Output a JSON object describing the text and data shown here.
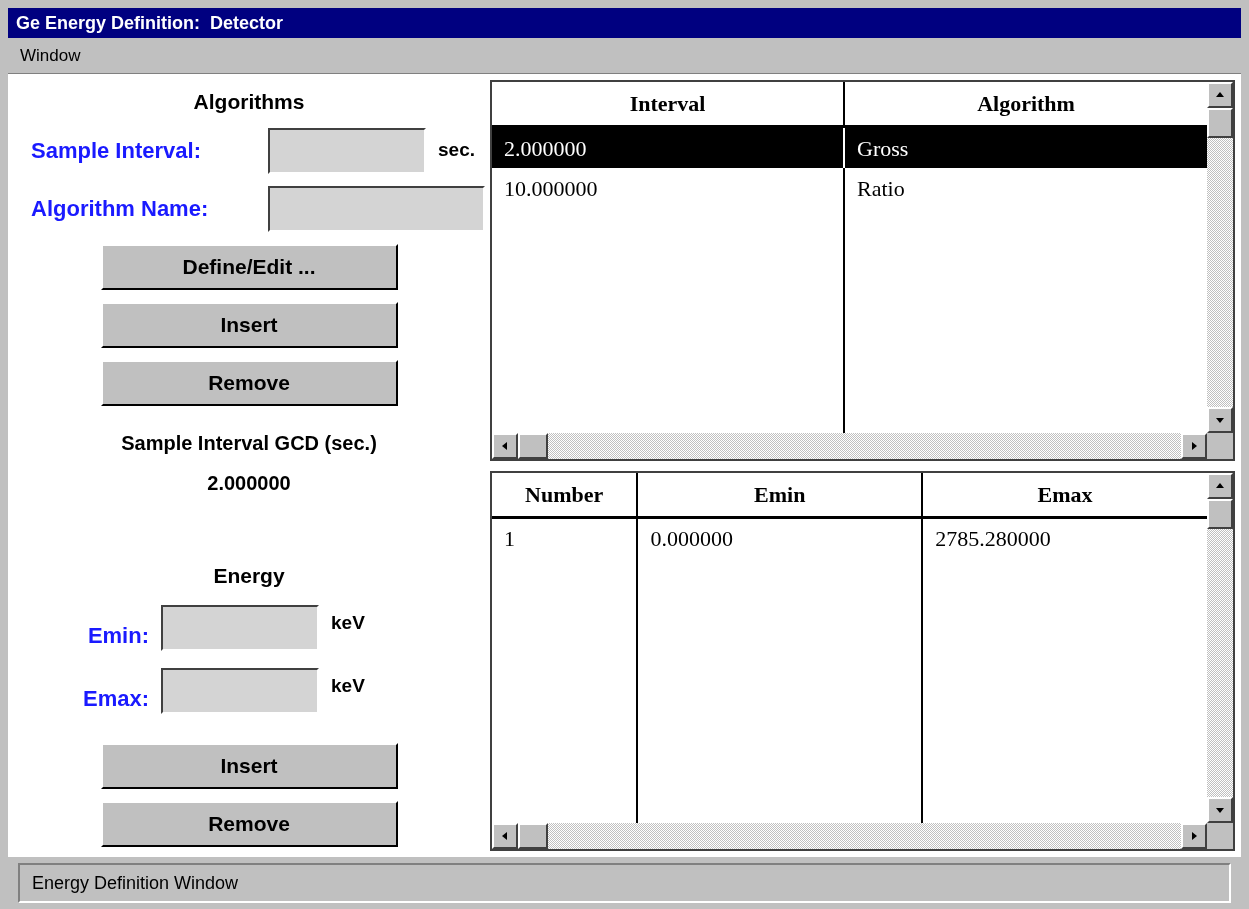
{
  "window": {
    "title": "Ge Energy Definition:  Detector"
  },
  "menu": [
    "Window"
  ],
  "algorithms": {
    "heading": "Algorithms",
    "fields": [
      {
        "label": "Sample Interval:",
        "unit": "sec."
      },
      {
        "label": "Algorithm Name:"
      }
    ],
    "buttons": [
      "Define/Edit ...",
      "Insert",
      "Remove"
    ],
    "gcd_label": "Sample Interval GCD (sec.)",
    "gcd_value": "2.000000"
  },
  "energy": {
    "heading": "Energy",
    "fields": [
      {
        "label": "Emin:",
        "unit": "keV"
      },
      {
        "label": "Emax:",
        "unit": "keV"
      }
    ],
    "buttons": [
      "Insert",
      "Remove"
    ]
  },
  "algorithm_table": {
    "columns": [
      "Interval",
      "Algorithm"
    ],
    "rows": [
      {
        "cells": [
          "2.000000",
          "Gross"
        ],
        "selected": true
      },
      {
        "cells": [
          "10.000000",
          "Ratio"
        ],
        "selected": false
      }
    ]
  },
  "energy_table": {
    "columns": [
      "Number",
      "Emin",
      "Emax"
    ],
    "rows": [
      {
        "cells": [
          "1",
          "0.000000",
          "2785.280000"
        ],
        "selected": false
      }
    ]
  },
  "status_bar": "Energy Definition Window"
}
